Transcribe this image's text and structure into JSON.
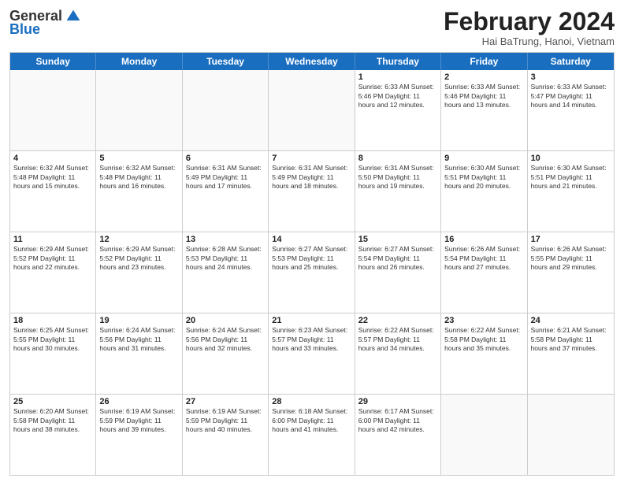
{
  "logo": {
    "general": "General",
    "blue": "Blue"
  },
  "title": "February 2024",
  "subtitle": "Hai BaTrung, Hanoi, Vietnam",
  "weekdays": [
    "Sunday",
    "Monday",
    "Tuesday",
    "Wednesday",
    "Thursday",
    "Friday",
    "Saturday"
  ],
  "rows": [
    [
      {
        "day": "",
        "info": ""
      },
      {
        "day": "",
        "info": ""
      },
      {
        "day": "",
        "info": ""
      },
      {
        "day": "",
        "info": ""
      },
      {
        "day": "1",
        "info": "Sunrise: 6:33 AM\nSunset: 5:46 PM\nDaylight: 11 hours and 12 minutes."
      },
      {
        "day": "2",
        "info": "Sunrise: 6:33 AM\nSunset: 5:46 PM\nDaylight: 11 hours and 13 minutes."
      },
      {
        "day": "3",
        "info": "Sunrise: 6:33 AM\nSunset: 5:47 PM\nDaylight: 11 hours and 14 minutes."
      }
    ],
    [
      {
        "day": "4",
        "info": "Sunrise: 6:32 AM\nSunset: 5:48 PM\nDaylight: 11 hours and 15 minutes."
      },
      {
        "day": "5",
        "info": "Sunrise: 6:32 AM\nSunset: 5:48 PM\nDaylight: 11 hours and 16 minutes."
      },
      {
        "day": "6",
        "info": "Sunrise: 6:31 AM\nSunset: 5:49 PM\nDaylight: 11 hours and 17 minutes."
      },
      {
        "day": "7",
        "info": "Sunrise: 6:31 AM\nSunset: 5:49 PM\nDaylight: 11 hours and 18 minutes."
      },
      {
        "day": "8",
        "info": "Sunrise: 6:31 AM\nSunset: 5:50 PM\nDaylight: 11 hours and 19 minutes."
      },
      {
        "day": "9",
        "info": "Sunrise: 6:30 AM\nSunset: 5:51 PM\nDaylight: 11 hours and 20 minutes."
      },
      {
        "day": "10",
        "info": "Sunrise: 6:30 AM\nSunset: 5:51 PM\nDaylight: 11 hours and 21 minutes."
      }
    ],
    [
      {
        "day": "11",
        "info": "Sunrise: 6:29 AM\nSunset: 5:52 PM\nDaylight: 11 hours and 22 minutes."
      },
      {
        "day": "12",
        "info": "Sunrise: 6:29 AM\nSunset: 5:52 PM\nDaylight: 11 hours and 23 minutes."
      },
      {
        "day": "13",
        "info": "Sunrise: 6:28 AM\nSunset: 5:53 PM\nDaylight: 11 hours and 24 minutes."
      },
      {
        "day": "14",
        "info": "Sunrise: 6:27 AM\nSunset: 5:53 PM\nDaylight: 11 hours and 25 minutes."
      },
      {
        "day": "15",
        "info": "Sunrise: 6:27 AM\nSunset: 5:54 PM\nDaylight: 11 hours and 26 minutes."
      },
      {
        "day": "16",
        "info": "Sunrise: 6:26 AM\nSunset: 5:54 PM\nDaylight: 11 hours and 27 minutes."
      },
      {
        "day": "17",
        "info": "Sunrise: 6:26 AM\nSunset: 5:55 PM\nDaylight: 11 hours and 29 minutes."
      }
    ],
    [
      {
        "day": "18",
        "info": "Sunrise: 6:25 AM\nSunset: 5:55 PM\nDaylight: 11 hours and 30 minutes."
      },
      {
        "day": "19",
        "info": "Sunrise: 6:24 AM\nSunset: 5:56 PM\nDaylight: 11 hours and 31 minutes."
      },
      {
        "day": "20",
        "info": "Sunrise: 6:24 AM\nSunset: 5:56 PM\nDaylight: 11 hours and 32 minutes."
      },
      {
        "day": "21",
        "info": "Sunrise: 6:23 AM\nSunset: 5:57 PM\nDaylight: 11 hours and 33 minutes."
      },
      {
        "day": "22",
        "info": "Sunrise: 6:22 AM\nSunset: 5:57 PM\nDaylight: 11 hours and 34 minutes."
      },
      {
        "day": "23",
        "info": "Sunrise: 6:22 AM\nSunset: 5:58 PM\nDaylight: 11 hours and 35 minutes."
      },
      {
        "day": "24",
        "info": "Sunrise: 6:21 AM\nSunset: 5:58 PM\nDaylight: 11 hours and 37 minutes."
      }
    ],
    [
      {
        "day": "25",
        "info": "Sunrise: 6:20 AM\nSunset: 5:58 PM\nDaylight: 11 hours and 38 minutes."
      },
      {
        "day": "26",
        "info": "Sunrise: 6:19 AM\nSunset: 5:59 PM\nDaylight: 11 hours and 39 minutes."
      },
      {
        "day": "27",
        "info": "Sunrise: 6:19 AM\nSunset: 5:59 PM\nDaylight: 11 hours and 40 minutes."
      },
      {
        "day": "28",
        "info": "Sunrise: 6:18 AM\nSunset: 6:00 PM\nDaylight: 11 hours and 41 minutes."
      },
      {
        "day": "29",
        "info": "Sunrise: 6:17 AM\nSunset: 6:00 PM\nDaylight: 11 hours and 42 minutes."
      },
      {
        "day": "",
        "info": ""
      },
      {
        "day": "",
        "info": ""
      }
    ]
  ]
}
